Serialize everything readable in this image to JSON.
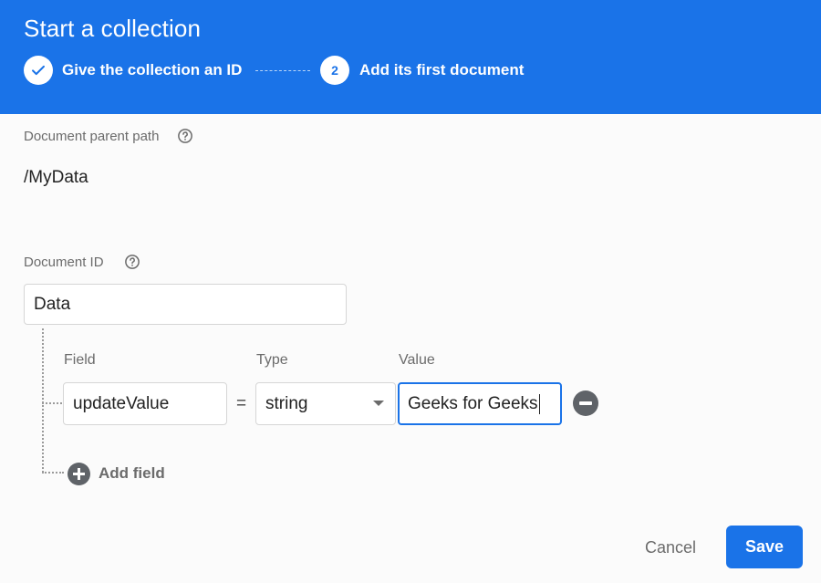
{
  "header": {
    "title": "Start a collection",
    "steps": [
      {
        "number": "",
        "label": "Give the collection an ID",
        "state": "completed"
      },
      {
        "number": "2",
        "label": "Add its first document",
        "state": "active"
      }
    ]
  },
  "parent_path": {
    "label": "Document parent path",
    "value": "/MyData",
    "help_icon": "help-circle-icon"
  },
  "document_id": {
    "label": "Document ID",
    "value": "Data",
    "help_icon": "help-circle-icon"
  },
  "fields": {
    "columns": {
      "field": "Field",
      "type": "Type",
      "value": "Value"
    },
    "equals": "=",
    "rows": [
      {
        "field": "updateValue",
        "type": "string",
        "value": "Geeks for Geeks"
      }
    ],
    "add_label": "Add field"
  },
  "actions": {
    "cancel": "Cancel",
    "save": "Save"
  },
  "colors": {
    "accent": "#1a73e8",
    "icon_gray": "#5f6368"
  }
}
